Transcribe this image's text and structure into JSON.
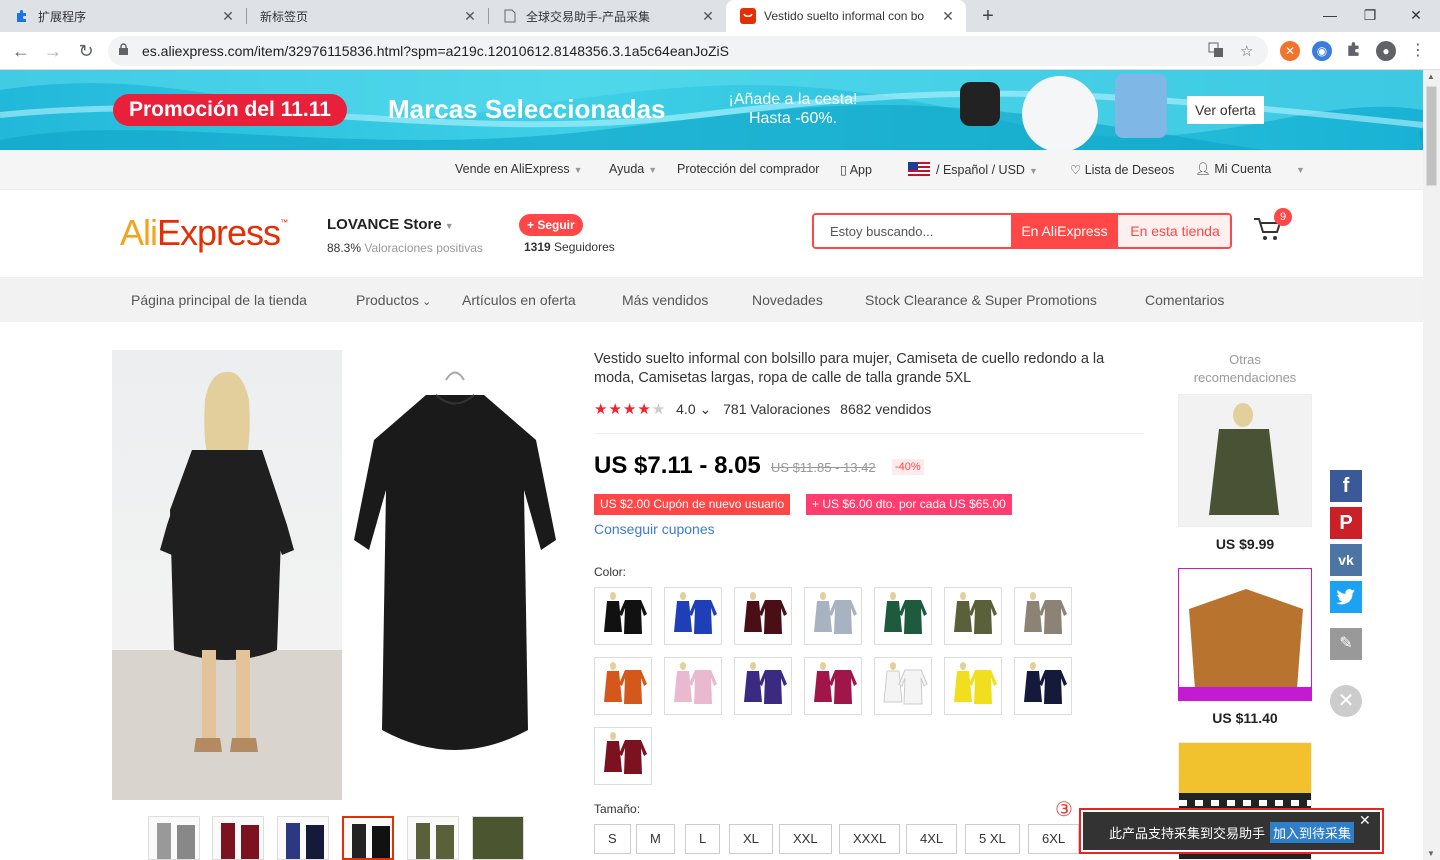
{
  "browser": {
    "tabs": [
      {
        "title": "扩展程序",
        "icon": "puzzle-icon"
      },
      {
        "title": "新标签页",
        "icon": ""
      },
      {
        "title": "全球交易助手-产品采集",
        "icon": "document-icon"
      },
      {
        "title": "Vestido suelto informal con bo",
        "icon": "aliexpress-icon"
      }
    ],
    "url": "es.aliexpress.com/item/32976115836.html?spm=a219c.12010612.8148356.3.1a5c64eanJoZiS"
  },
  "banner": {
    "promo": "Promoción del 11.11",
    "headline": "Marcas Seleccionadas",
    "sub_line1": "¡Añade a la cesta!",
    "sub_line2": "Hasta -60%.",
    "cta": "Ver oferta"
  },
  "toplinks": {
    "sell": "Vende en AliExpress",
    "help": "Ayuda",
    "protection": "Protección del comprador",
    "app": "App",
    "locale": "/ Español / USD",
    "wishlist": "Lista de Deseos",
    "account": "Mi Cuenta"
  },
  "header": {
    "store_name": "LOVANCE Store",
    "rating_pct": "88.3%",
    "rating_text": "Valoraciones positivas",
    "follow_label": "+ Seguir",
    "followers_count": "1319",
    "followers_label": "Seguidores",
    "search_placeholder": "Estoy buscando...",
    "search_all": "En AliExpress",
    "search_store": "En esta tienda",
    "cart_count": "9"
  },
  "storenav": [
    "Página principal de la tienda",
    "Productos",
    "Artículos en oferta",
    "Más vendidos",
    "Novedades",
    "Stock Clearance & Super Promotions",
    "Comentarios"
  ],
  "product": {
    "title": "Vestido suelto informal con bolsillo para mujer, Camiseta de cuello redondo a la moda, Camisetas largas, ropa de calle de talla grande 5XL",
    "rating": "4.0",
    "reviews": "781 Valoraciones",
    "sold": "8682 vendidos",
    "price": "US $7.11 - 8.05",
    "old_price": "US $11.85 - 13.42",
    "discount": "-40%",
    "coupon_new": "US $2.00 Cupón de nuevo usuario",
    "coupon_spend": "+ US $6.00 dto. por cada US $65.00",
    "get_coupons": "Conseguir cupones",
    "color_label": "Color:",
    "size_label": "Tamaño:",
    "colors": [
      "#111111",
      "#1f3fb8",
      "#4a0f16",
      "#a8b3c2",
      "#1e5a3e",
      "#59603a",
      "#8c8275",
      "#d4571b",
      "#e8b9cf",
      "#3b2a82",
      "#a0164a",
      "#f4f4f4",
      "#f1df1f",
      "#131a3a",
      "#7c1120"
    ],
    "sizes": [
      "S",
      "M",
      "L",
      "XL",
      "XXL",
      "XXXL",
      "4XL",
      "5 XL",
      "6XL"
    ]
  },
  "recommendations": {
    "title": "Otras recomendaciones",
    "items": [
      {
        "price": "US $9.99"
      },
      {
        "price": "US $11.40"
      },
      {
        "price": ""
      }
    ]
  },
  "plugin": {
    "number": "③",
    "text": "此产品支持采集到交易助手",
    "button": "加入到待采集",
    "close": "✕"
  }
}
